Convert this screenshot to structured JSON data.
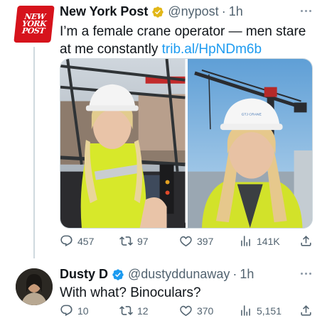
{
  "main_tweet": {
    "author_name": "New York Post",
    "handle": "@nypost",
    "separator": "·",
    "time": "1h",
    "logo_lines": [
      "NEW",
      "YORK",
      "POST"
    ],
    "text": "I’m a female crane operator — men stare at me constantly ",
    "link_text": "trib.al/HpNDm6b",
    "photo_hard_hat_text": "GTJ CRANE",
    "stats": {
      "replies": "457",
      "retweets": "97",
      "likes": "397",
      "views": "141K"
    }
  },
  "reply_tweet": {
    "author_name": "Dusty D",
    "handle": "@dustyddunaway",
    "separator": "·",
    "time": "1h",
    "text": "With what? Binoculars?",
    "stats": {
      "replies": "10",
      "retweets": "12",
      "likes": "370",
      "views": "5,151"
    }
  },
  "colors": {
    "text_primary": "#0f1419",
    "text_secondary": "#536471",
    "link": "#1d9bf0",
    "verified_badge": "#e2b719",
    "nyp_red": "#d6131c",
    "divider": "#cfd9de"
  },
  "icons": {
    "reply": "reply-icon",
    "retweet": "retweet-icon",
    "like": "heart-icon",
    "views": "bar-chart-icon",
    "share": "share-icon",
    "more": "more-icon",
    "verified": "verified-badge-icon"
  }
}
